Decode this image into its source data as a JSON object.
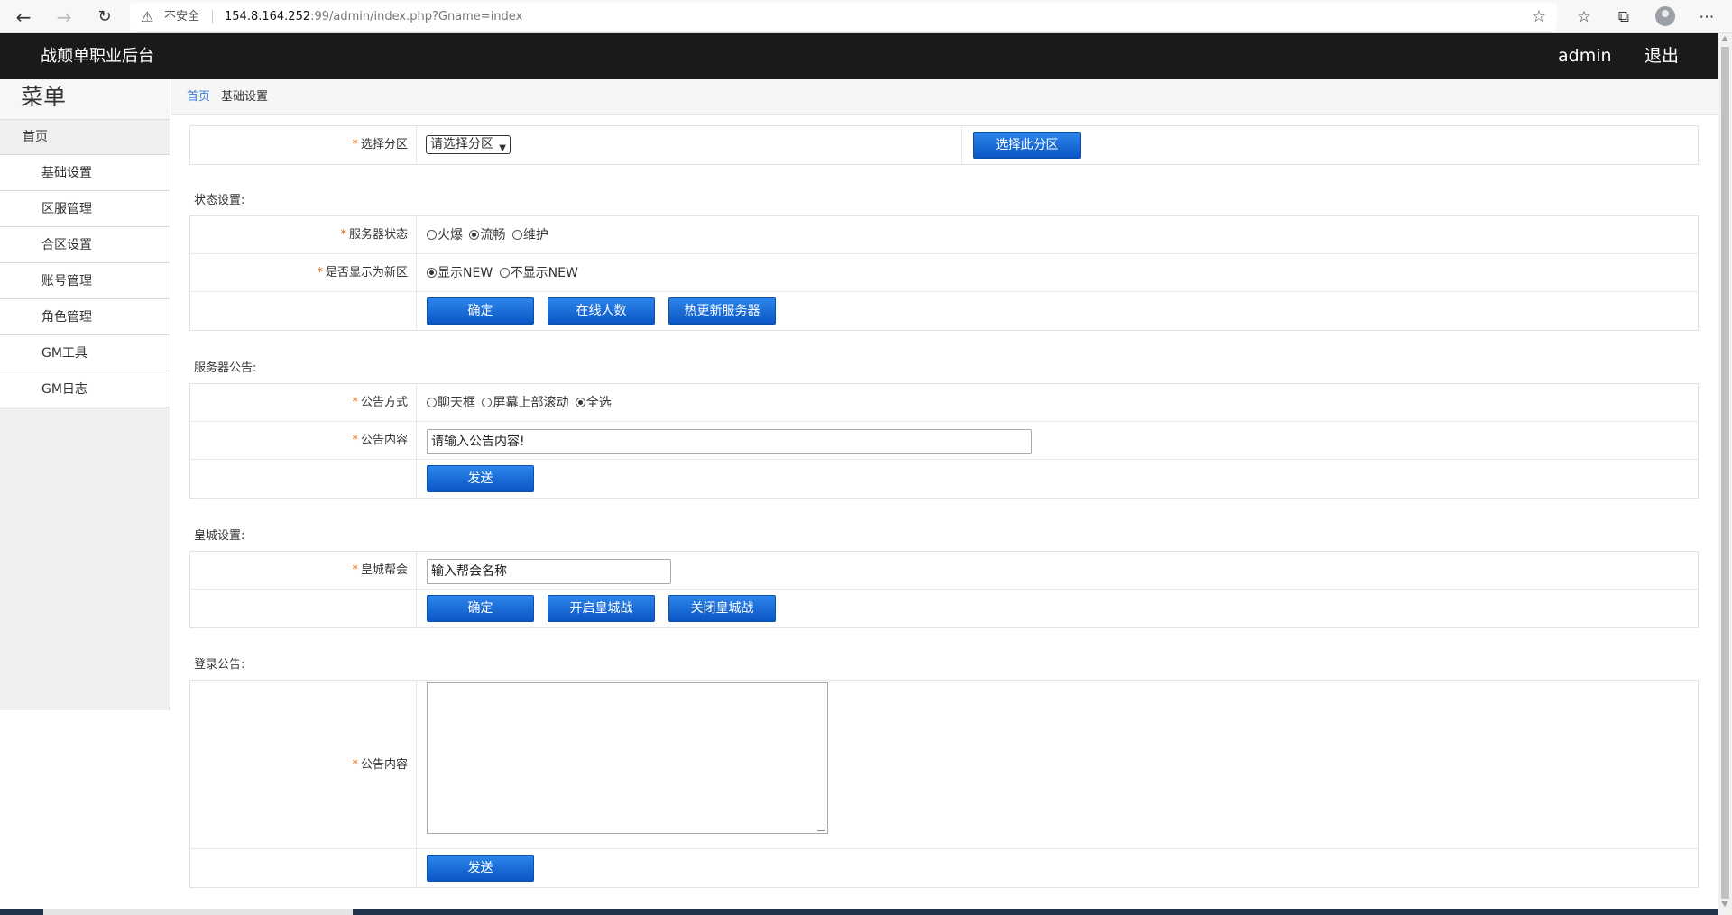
{
  "browser": {
    "insecure_label": "不安全",
    "url_host": "154.8.164.252",
    "url_path": ":99/admin/index.php?Gname=index"
  },
  "header": {
    "title": "战颠单职业后台",
    "user": "admin",
    "logout": "退出"
  },
  "sidebar": {
    "title": "菜单",
    "home": "首页",
    "items": [
      "基础设置",
      "区服管理",
      "合区设置",
      "账号管理",
      "角色管理",
      "GM工具",
      "GM日志"
    ]
  },
  "breadcrumb": {
    "home": "首页",
    "current": "基础设置"
  },
  "zone": {
    "label": "选择分区",
    "select_value": "请选择分区",
    "button": "选择此分区"
  },
  "status": {
    "section_title": "状态设置:",
    "server_status_label": "服务器状态",
    "server_status_options": [
      "火爆",
      "流畅",
      "维护"
    ],
    "server_status_selected": "流畅",
    "new_label": "是否显示为新区",
    "new_options": [
      "显示NEW",
      "不显示NEW"
    ],
    "new_selected": "显示NEW",
    "buttons": [
      "确定",
      "在线人数",
      "热更新服务器"
    ]
  },
  "announce": {
    "section_title": "服务器公告:",
    "mode_label": "公告方式",
    "mode_options": [
      "聊天框",
      "屏幕上部滚动",
      "全选"
    ],
    "mode_selected": "全选",
    "content_label": "公告内容",
    "content_value": "请输入公告内容!",
    "send": "发送"
  },
  "castle": {
    "section_title": "皇城设置:",
    "guild_label": "皇城帮会",
    "guild_value": "输入帮会名称",
    "buttons": [
      "确定",
      "开启皇城战",
      "关闭皇城战"
    ]
  },
  "login_notice": {
    "section_title": "登录公告:",
    "content_label": "公告内容",
    "content_value": "",
    "send": "发送"
  },
  "colors": {
    "header_bg": "#1a1a1a",
    "button_blue": "#0b56c6",
    "required_star": "#e05a00",
    "link_blue": "#3a7bd5"
  }
}
